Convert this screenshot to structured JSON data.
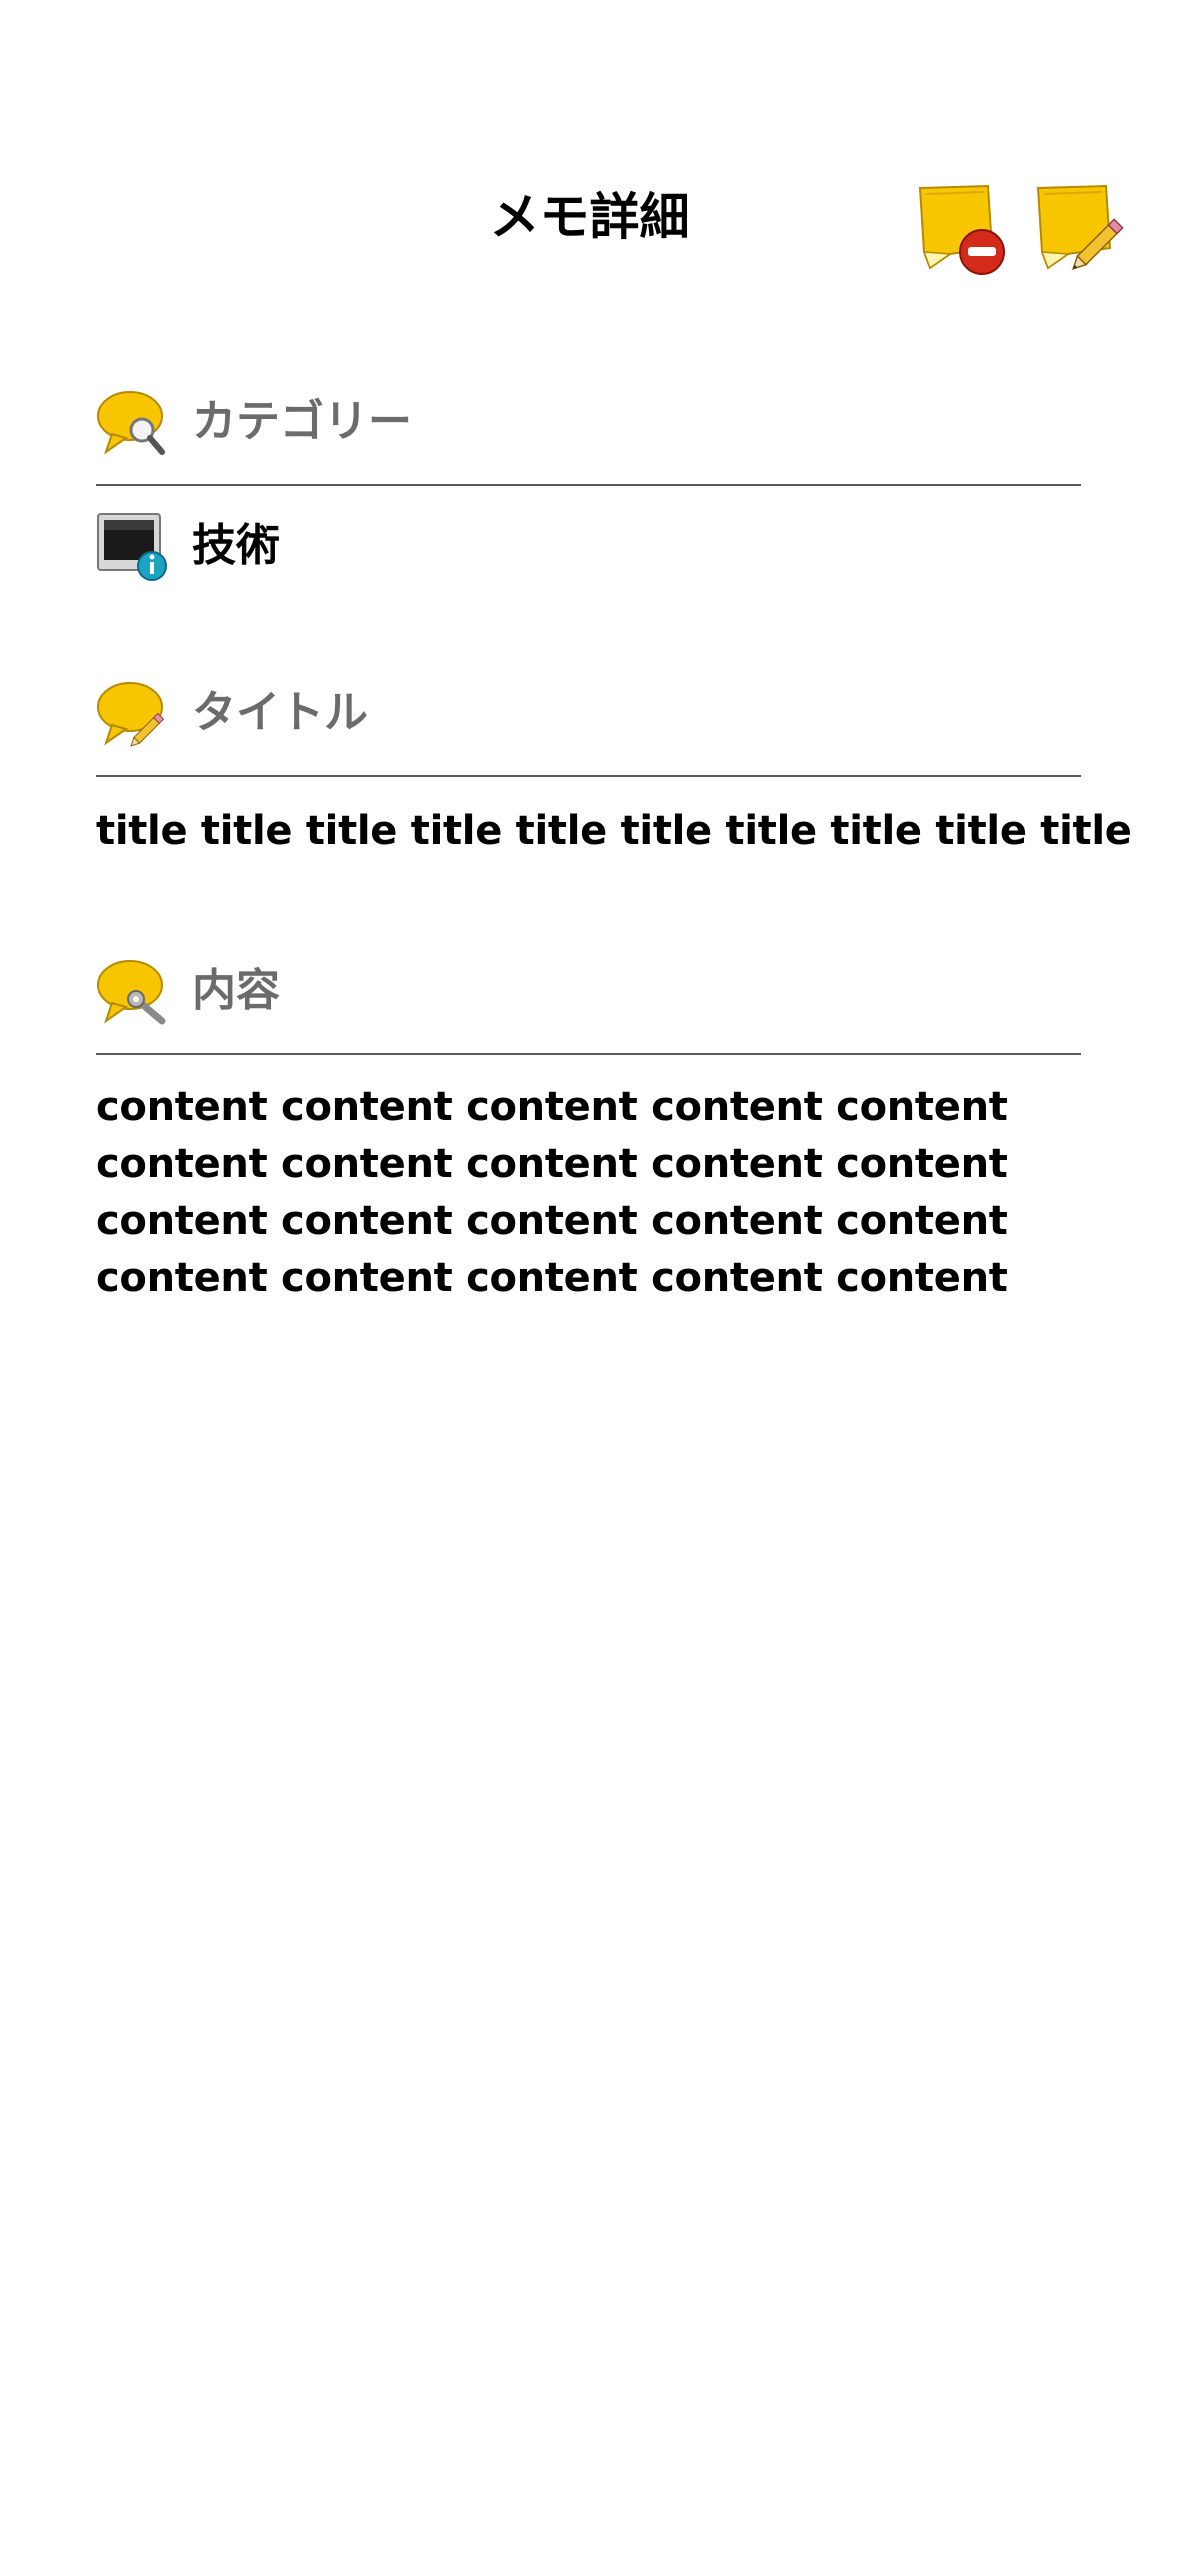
{
  "header": {
    "title": "メモ詳細",
    "delete_button_icon": "sticky-note-delete-icon",
    "edit_button_icon": "sticky-note-edit-icon"
  },
  "category": {
    "label": "カテゴリー",
    "label_icon": "speech-bubble-search-icon",
    "value": "技術",
    "value_icon": "monitor-info-icon"
  },
  "title": {
    "label": "タイトル",
    "label_icon": "speech-bubble-pencil-icon",
    "value": "title title title title title title title title title title"
  },
  "content": {
    "label": "内容",
    "label_icon": "speech-bubble-wrench-icon",
    "value": "content content content content content\ncontent content content content content\ncontent content content content content\ncontent content content content content"
  },
  "colors": {
    "label_gray": "#6b6b6b",
    "divider": "#5a5a5a",
    "note_yellow": "#f7c600",
    "delete_red": "#d42a1a",
    "info_teal": "#1ba3c4"
  }
}
